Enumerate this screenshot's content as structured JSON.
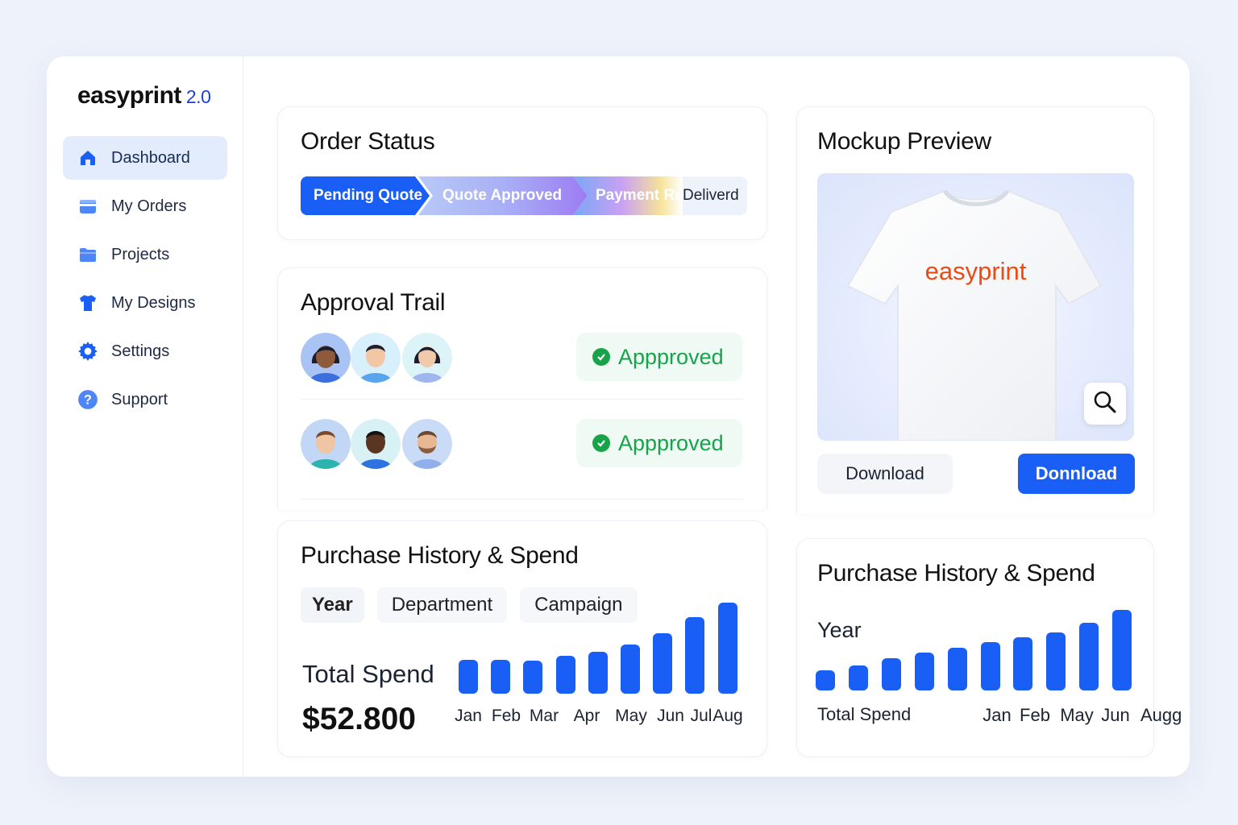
{
  "app": {
    "name": "easyprint",
    "version": "2.0"
  },
  "sidebar": {
    "items": [
      {
        "label": "Dashboard",
        "icon": "home-icon",
        "active": true
      },
      {
        "label": "My Orders",
        "icon": "orders-icon"
      },
      {
        "label": "Projects",
        "icon": "folder-icon"
      },
      {
        "label": "My Designs",
        "icon": "tshirt-icon"
      },
      {
        "label": "Settings",
        "icon": "gear-icon"
      },
      {
        "label": "Support",
        "icon": "help-icon"
      }
    ]
  },
  "order_status": {
    "title": "Order Status",
    "steps": [
      "Pending Quote",
      "Quote Approved",
      "Payment Re...",
      "Deliverd"
    ],
    "current_step": 1
  },
  "approval_trail": {
    "title": "Approval Trail",
    "rows": [
      {
        "status": "Appproved"
      },
      {
        "status": "Appproved"
      }
    ]
  },
  "mockup": {
    "title": "Mockup Preview",
    "shirt_text": "easyprint",
    "download_label": "Download",
    "download_primary_label": "Donnload"
  },
  "purchase_main": {
    "title": "Purchase History & Spend",
    "tabs": [
      "Year",
      "Department",
      "Campaign"
    ],
    "selected_tab": "Year",
    "total_spend_label": "Total Spend",
    "total_spend_value": "$52.800"
  },
  "purchase_side": {
    "title": "Purchase History & Spend",
    "year_label": "Year",
    "total_spend_label": "Total Spend"
  },
  "colors": {
    "accent": "#1a5ff5",
    "approved": "#16a34a",
    "shirt_logo": "#ee4a14"
  },
  "chart_data": [
    {
      "type": "bar",
      "categories": [
        "Jan",
        "Feb",
        "Mar",
        "Apr",
        "May",
        "Jun",
        "Jul",
        "Aug"
      ],
      "series": [
        {
          "values": [
            42,
            42,
            41,
            47,
            52,
            61,
            75,
            95,
            113
          ]
        }
      ],
      "visible_tick_labels": [
        "Jan",
        "Feb",
        "Mar",
        "Apr",
        "May",
        "Jun",
        "Jul",
        "Aug"
      ]
    },
    {
      "type": "bar",
      "categories": [
        "Jan",
        "Feb",
        "May",
        "Jun",
        "Augg"
      ],
      "series": [
        {
          "values": [
            25,
            31,
            40,
            47,
            53,
            60,
            66,
            72,
            84,
            100
          ]
        }
      ],
      "visible_tick_labels": [
        "Jan",
        "Feb",
        "May",
        "Jun",
        "Augg"
      ]
    }
  ]
}
